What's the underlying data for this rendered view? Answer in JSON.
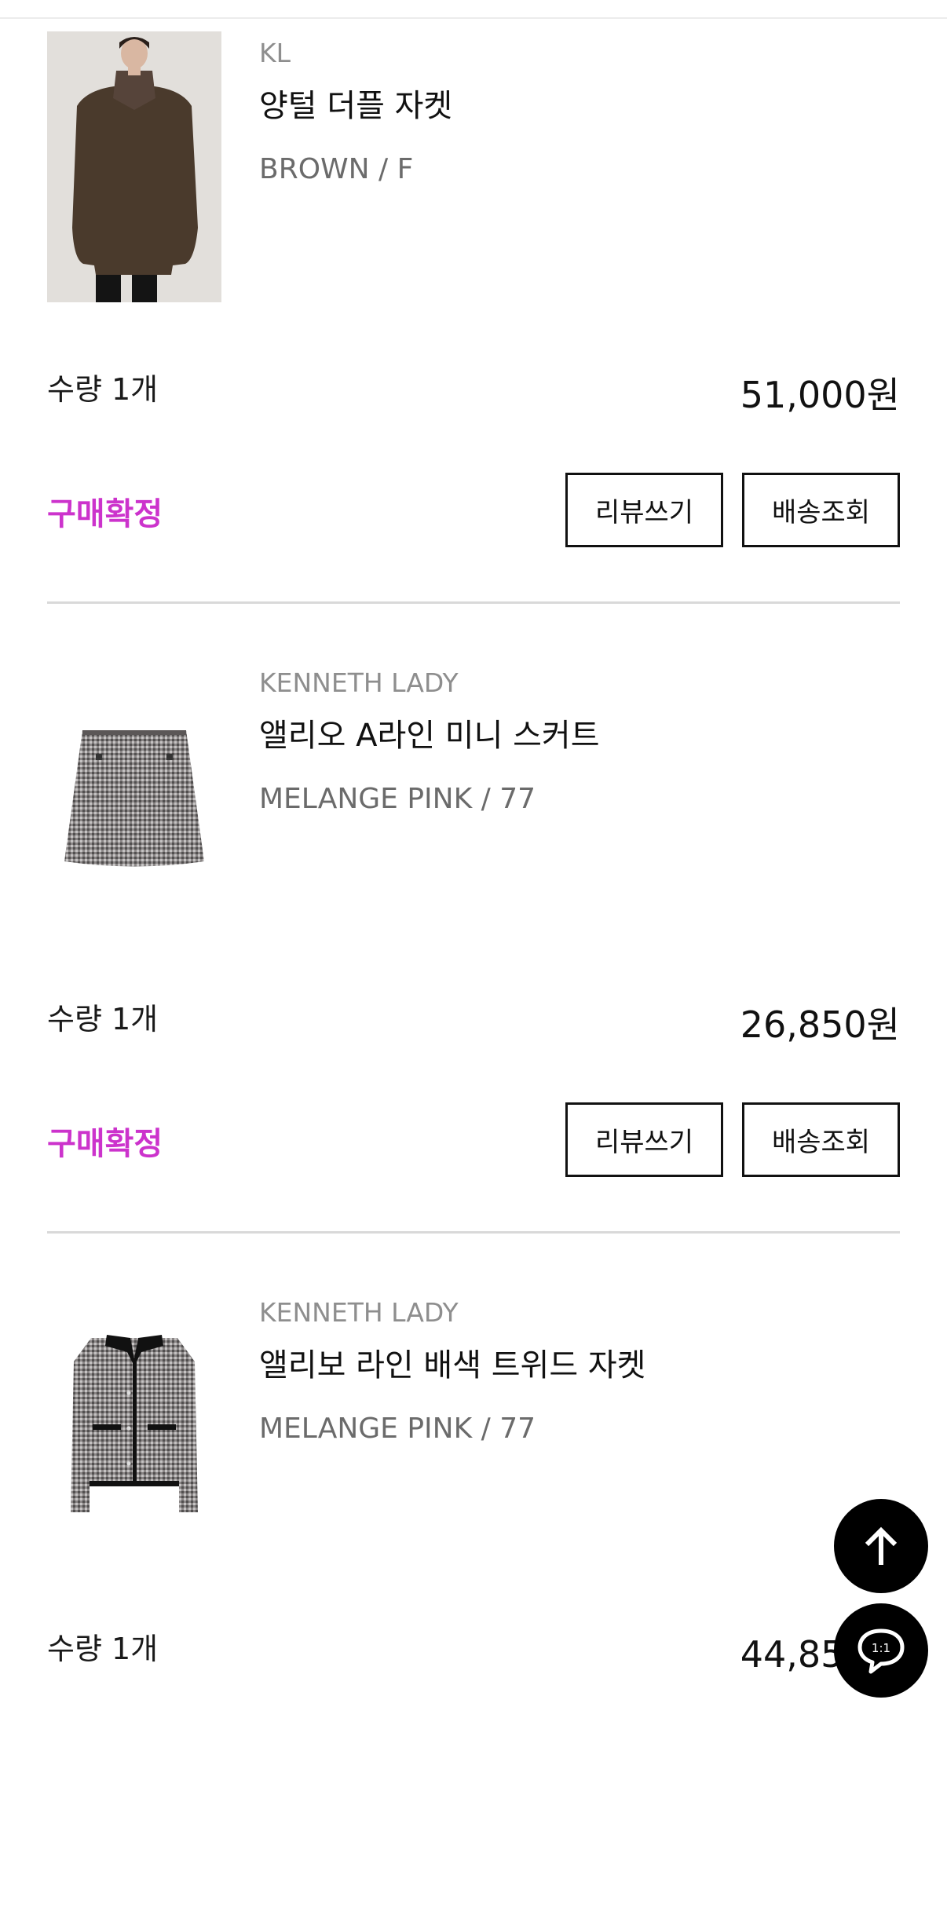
{
  "items": [
    {
      "brand": "KL",
      "name": "양털 더플 자켓",
      "option": "BROWN / F",
      "quantity": "수량 1개",
      "price": "51,000원",
      "status": "구매확정",
      "review_label": "리뷰쓰기",
      "shipping_label": "배송조회"
    },
    {
      "brand": "KENNETH LADY",
      "name": "앨리오 A라인 미니 스커트",
      "option": "MELANGE PINK / 77",
      "quantity": "수량 1개",
      "price": "26,850원",
      "status": "구매확정",
      "review_label": "리뷰쓰기",
      "shipping_label": "배송조회"
    },
    {
      "brand": "KENNETH LADY",
      "name": "앨리보 라인 배색 트위드 자켓",
      "option": "MELANGE PINK / 77",
      "quantity": "수량 1개",
      "price": "44,850원"
    }
  ],
  "floating": {
    "scroll_top_icon": "arrow-up-icon",
    "chat_icon": "chat-bubble-icon",
    "chat_label": "1:1"
  },
  "colors": {
    "status": "#cc33cc",
    "fab": "#000000"
  }
}
